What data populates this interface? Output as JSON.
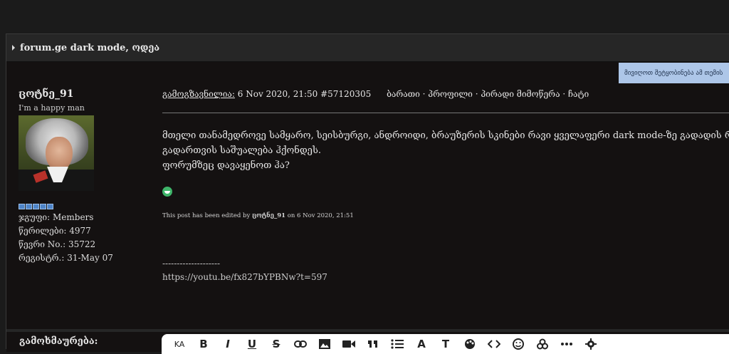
{
  "topic": {
    "title": "forum.ge dark mode, ოდეა"
  },
  "notify_button": {
    "label": "მივიღოთ შეტყობინება ამ თემის"
  },
  "user": {
    "name": "ცოტნე_91",
    "title": "I'm a happy man",
    "pips": 5,
    "stats": [
      "ჯგუფი: Members",
      "წერილები: 4977",
      "წევრი No.: 35722",
      "რეგისტრ.: 31-May 07"
    ]
  },
  "post": {
    "sent_label": "გამოგზავნილია:",
    "sent_value": " 6 Nov 2020, 21:50  #57120305",
    "links": "ბარათი · პროფილი · პირადი მიმოწერა · ჩატი",
    "line1": "მთელი თანამედროვე სამყარო, სეისბურგი, ანდროიდი, ბრაუზერის სკინები რავი ყველაფერი dark mode-ზე გადადის რ",
    "line2": "გადართვის საშუალება ჰქონდეს.",
    "question": "ფორუმზეც დავაყენოთ ჰა?",
    "edited_prefix": "This post has been edited by ",
    "edited_user": "ცოტნე_91",
    "edited_suffix": " on 6 Nov 2020, 21:51",
    "sig_line": "--------------------",
    "sig_url": "https://youtu.be/fx827bYPBNw?t=597"
  },
  "reply": {
    "label": "გამოხმაურება:",
    "toolbar": [
      "KA",
      "B",
      "I",
      "U",
      "S",
      "link",
      "image",
      "video",
      "quote",
      "list",
      "A",
      "T",
      "palette",
      "code",
      "emoji",
      "biohazard",
      "more",
      "gear"
    ]
  }
}
